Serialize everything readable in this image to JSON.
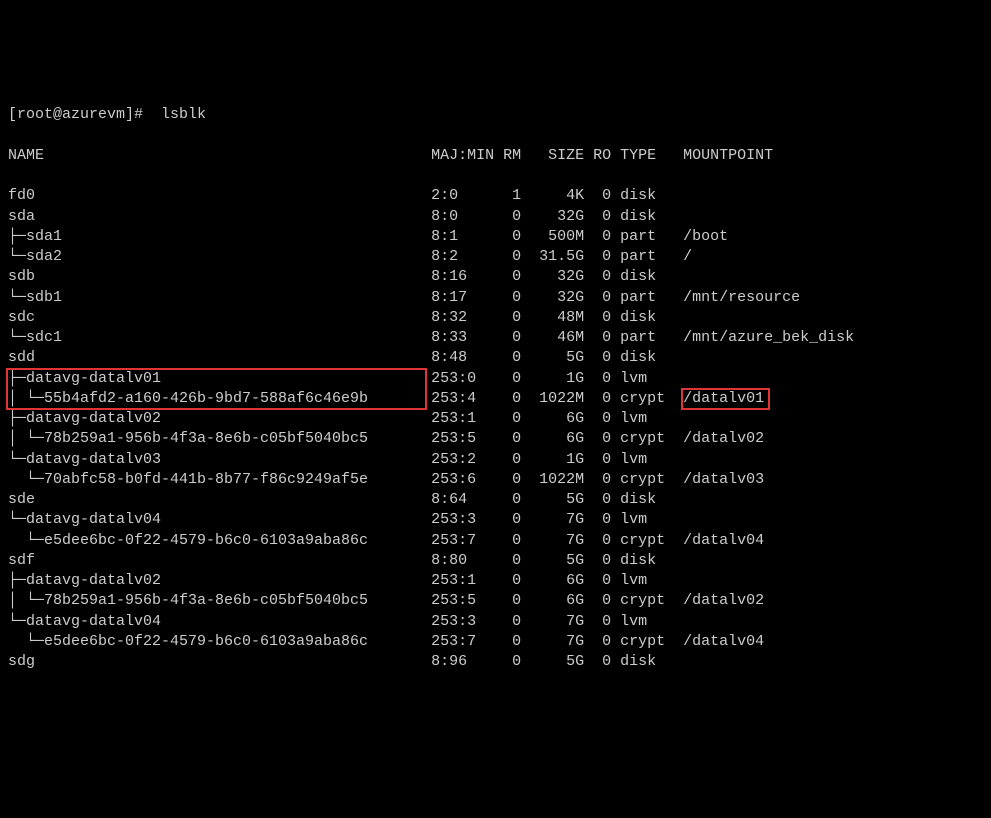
{
  "prompt": "[root@azurevm]#  lsblk",
  "header": {
    "name": "NAME",
    "majmin": "MAJ:MIN",
    "rm": "RM",
    "size": "SIZE",
    "ro": "RO",
    "type": "TYPE",
    "mount": "MOUNTPOINT"
  },
  "rows": [
    {
      "name": "fd0",
      "maj": "2:0",
      "rm": "1",
      "size": "4K",
      "ro": "0",
      "type": "disk",
      "mount": ""
    },
    {
      "name": "sda",
      "maj": "8:0",
      "rm": "0",
      "size": "32G",
      "ro": "0",
      "type": "disk",
      "mount": ""
    },
    {
      "name": "├─sda1",
      "maj": "8:1",
      "rm": "0",
      "size": "500M",
      "ro": "0",
      "type": "part",
      "mount": "/boot"
    },
    {
      "name": "└─sda2",
      "maj": "8:2",
      "rm": "0",
      "size": "31.5G",
      "ro": "0",
      "type": "part",
      "mount": "/"
    },
    {
      "name": "sdb",
      "maj": "8:16",
      "rm": "0",
      "size": "32G",
      "ro": "0",
      "type": "disk",
      "mount": ""
    },
    {
      "name": "└─sdb1",
      "maj": "8:17",
      "rm": "0",
      "size": "32G",
      "ro": "0",
      "type": "part",
      "mount": "/mnt/resource"
    },
    {
      "name": "sdc",
      "maj": "8:32",
      "rm": "0",
      "size": "48M",
      "ro": "0",
      "type": "disk",
      "mount": ""
    },
    {
      "name": "└─sdc1",
      "maj": "8:33",
      "rm": "0",
      "size": "46M",
      "ro": "0",
      "type": "part",
      "mount": "/mnt/azure_bek_disk"
    },
    {
      "name": "sdd",
      "maj": "8:48",
      "rm": "0",
      "size": "5G",
      "ro": "0",
      "type": "disk",
      "mount": ""
    },
    {
      "name": "├─datavg-datalv01",
      "maj": "253:0",
      "rm": "0",
      "size": "1G",
      "ro": "0",
      "type": "lvm",
      "mount": ""
    },
    {
      "name": "│ └─55b4afd2-a160-426b-9bd7-588af6c46e9b",
      "maj": "253:4",
      "rm": "0",
      "size": "1022M",
      "ro": "0",
      "type": "crypt",
      "mount": "/datalv01"
    },
    {
      "name": "├─datavg-datalv02",
      "maj": "253:1",
      "rm": "0",
      "size": "6G",
      "ro": "0",
      "type": "lvm",
      "mount": ""
    },
    {
      "name": "│ └─78b259a1-956b-4f3a-8e6b-c05bf5040bc5",
      "maj": "253:5",
      "rm": "0",
      "size": "6G",
      "ro": "0",
      "type": "crypt",
      "mount": "/datalv02"
    },
    {
      "name": "└─datavg-datalv03",
      "maj": "253:2",
      "rm": "0",
      "size": "1G",
      "ro": "0",
      "type": "lvm",
      "mount": ""
    },
    {
      "name": "  └─70abfc58-b0fd-441b-8b77-f86c9249af5e",
      "maj": "253:6",
      "rm": "0",
      "size": "1022M",
      "ro": "0",
      "type": "crypt",
      "mount": "/datalv03"
    },
    {
      "name": "sde",
      "maj": "8:64",
      "rm": "0",
      "size": "5G",
      "ro": "0",
      "type": "disk",
      "mount": ""
    },
    {
      "name": "└─datavg-datalv04",
      "maj": "253:3",
      "rm": "0",
      "size": "7G",
      "ro": "0",
      "type": "lvm",
      "mount": ""
    },
    {
      "name": "  └─e5dee6bc-0f22-4579-b6c0-6103a9aba86c",
      "maj": "253:7",
      "rm": "0",
      "size": "7G",
      "ro": "0",
      "type": "crypt",
      "mount": "/datalv04"
    },
    {
      "name": "sdf",
      "maj": "8:80",
      "rm": "0",
      "size": "5G",
      "ro": "0",
      "type": "disk",
      "mount": ""
    },
    {
      "name": "├─datavg-datalv02",
      "maj": "253:1",
      "rm": "0",
      "size": "6G",
      "ro": "0",
      "type": "lvm",
      "mount": ""
    },
    {
      "name": "│ └─78b259a1-956b-4f3a-8e6b-c05bf5040bc5",
      "maj": "253:5",
      "rm": "0",
      "size": "6G",
      "ro": "0",
      "type": "crypt",
      "mount": "/datalv02"
    },
    {
      "name": "└─datavg-datalv04",
      "maj": "253:3",
      "rm": "0",
      "size": "7G",
      "ro": "0",
      "type": "lvm",
      "mount": ""
    },
    {
      "name": "  └─e5dee6bc-0f22-4579-b6c0-6103a9aba86c",
      "maj": "253:7",
      "rm": "0",
      "size": "7G",
      "ro": "0",
      "type": "crypt",
      "mount": "/datalv04"
    },
    {
      "name": "sdg",
      "maj": "8:96",
      "rm": "0",
      "size": "5G",
      "ro": "0",
      "type": "disk",
      "mount": ""
    }
  ],
  "highlight_boxes": [
    {
      "top_row": 10,
      "rows": 2
    },
    {
      "mount_row": 11
    }
  ]
}
